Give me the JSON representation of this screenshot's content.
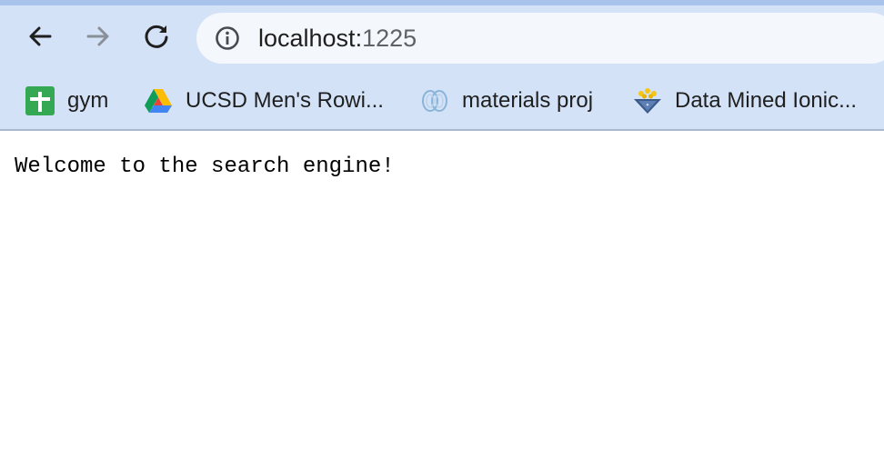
{
  "browser": {
    "address_bar": {
      "host": "localhost:",
      "port": "1225",
      "icon": "info-icon"
    },
    "nav": {
      "back_icon": "back-arrow-icon",
      "forward_icon": "forward-arrow-icon",
      "reload_icon": "reload-icon"
    },
    "bookmarks": [
      {
        "label": "gym",
        "icon": "google-sheets-icon"
      },
      {
        "label": "UCSD Men's Rowi...",
        "icon": "google-drive-icon"
      },
      {
        "label": "materials proj",
        "icon": "materials-project-icon"
      },
      {
        "label": "Data Mined Ionic...",
        "icon": "shield-crest-icon"
      }
    ],
    "colors": {
      "chrome_bg": "#d3e2f7",
      "omnibox_bg": "#f4f7fc",
      "page_bg": "#ffffff"
    }
  },
  "page": {
    "welcome_text": "Welcome to the search engine!"
  }
}
